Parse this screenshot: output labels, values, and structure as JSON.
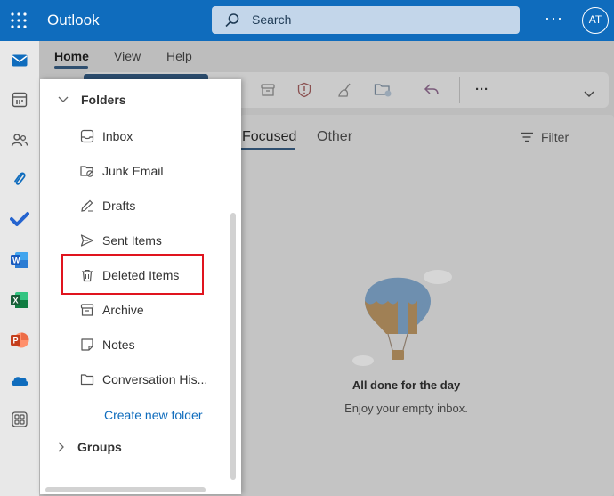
{
  "app": {
    "title": "Outlook",
    "search_placeholder": "Search",
    "more": "···",
    "avatar_initials": "AT"
  },
  "ribbon": {
    "tabs": [
      "Home",
      "View",
      "Help"
    ],
    "more": "···"
  },
  "folders": {
    "heading": "Folders",
    "items": [
      {
        "label": "Inbox",
        "icon": "inbox-icon"
      },
      {
        "label": "Junk Email",
        "icon": "junk-icon"
      },
      {
        "label": "Drafts",
        "icon": "drafts-icon"
      },
      {
        "label": "Sent Items",
        "icon": "sent-icon"
      },
      {
        "label": "Deleted Items",
        "icon": "trash-icon"
      },
      {
        "label": "Archive",
        "icon": "archive-icon"
      },
      {
        "label": "Notes",
        "icon": "notes-icon"
      },
      {
        "label": "Conversation His...",
        "icon": "folder-icon"
      }
    ],
    "create_link": "Create new folder",
    "groups_heading": "Groups"
  },
  "mail_pane": {
    "tabs": [
      "Focused",
      "Other"
    ],
    "filter_label": "Filter",
    "empty_title": "All done for the day",
    "empty_subtitle": "Enjoy your empty inbox."
  },
  "highlight_color": "#e0141e",
  "brand_color": "#0f6cbd"
}
